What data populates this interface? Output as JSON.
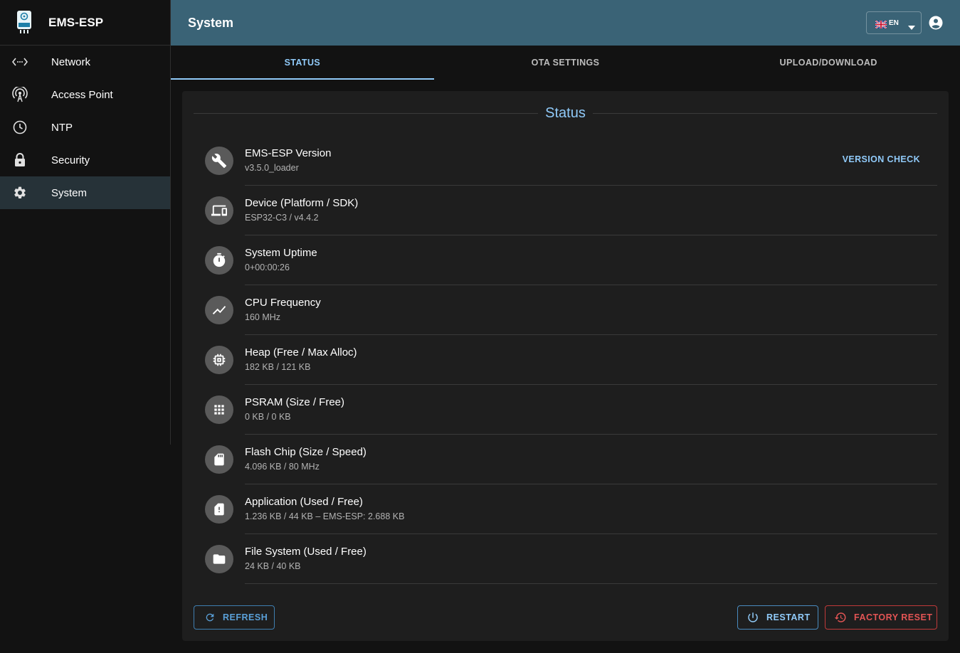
{
  "app": {
    "name": "EMS-ESP"
  },
  "sidebar": {
    "items": [
      {
        "label": "Network",
        "icon": "network-arrows-icon",
        "active": false
      },
      {
        "label": "Access Point",
        "icon": "access-point-icon",
        "active": false
      },
      {
        "label": "NTP",
        "icon": "clock-icon",
        "active": false
      },
      {
        "label": "Security",
        "icon": "lock-icon",
        "active": false
      },
      {
        "label": "System",
        "icon": "gear-icon",
        "active": true
      }
    ]
  },
  "header": {
    "title": "System",
    "language": "EN",
    "language_flag": "uk-flag-icon",
    "account_icon": "account-circle-icon"
  },
  "tabs": [
    {
      "label": "STATUS",
      "active": true
    },
    {
      "label": "OTA SETTINGS",
      "active": false
    },
    {
      "label": "UPLOAD/DOWNLOAD",
      "active": false
    }
  ],
  "status": {
    "title": "Status",
    "version_check_label": "VERSION CHECK",
    "rows": [
      {
        "icon": "wrench-icon",
        "primary": "EMS-ESP Version",
        "secondary": "v3.5.0_loader"
      },
      {
        "icon": "devices-icon",
        "primary": "Device (Platform / SDK)",
        "secondary": "ESP32-C3 / v4.4.2"
      },
      {
        "icon": "timer-icon",
        "primary": "System Uptime",
        "secondary": "0+00:00:26"
      },
      {
        "icon": "trending-up-icon",
        "primary": "CPU Frequency",
        "secondary": "160 MHz"
      },
      {
        "icon": "memory-chip-icon",
        "primary": "Heap (Free / Max Alloc)",
        "secondary": "182 KB / 121 KB"
      },
      {
        "icon": "apps-grid-icon",
        "primary": "PSRAM (Size / Free)",
        "secondary": "0 KB / 0 KB"
      },
      {
        "icon": "sd-card-icon",
        "primary": "Flash Chip (Size / Speed)",
        "secondary": "4.096 KB / 80 MHz"
      },
      {
        "icon": "sd-card-alert-icon",
        "primary": "Application (Used / Free)",
        "secondary": "1.236 KB / 44 KB – EMS-ESP: 2.688 KB"
      },
      {
        "icon": "folder-icon",
        "primary": "File System (Used / Free)",
        "secondary": "24 KB / 40 KB"
      }
    ]
  },
  "actions": {
    "refresh_label": "REFRESH",
    "restart_label": "RESTART",
    "factory_reset_label": "FACTORY RESET"
  },
  "colors": {
    "header_bg": "#3a6376",
    "accent": "#90caf9",
    "danger": "#e25454",
    "active_nav_bg": "#263238"
  }
}
